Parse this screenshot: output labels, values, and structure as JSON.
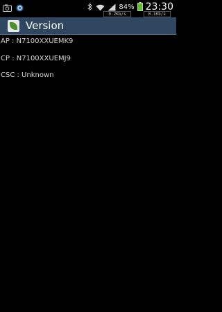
{
  "status_bar": {
    "battery_percent": "84%",
    "time": "23:30",
    "download_speed": "0.2Kb/s",
    "upload_speed": "0.1Kb/s",
    "icons": [
      "gallery-icon",
      "sync-icon",
      "bluetooth-icon",
      "wifi-icon",
      "signal-icon",
      "battery-icon"
    ]
  },
  "action_bar": {
    "title": "Version",
    "icon": "app-icon"
  },
  "version_info": [
    {
      "text": "AP : N7100XXUEMK9"
    },
    {
      "text": "CP : N7100XXUEMJ9"
    },
    {
      "text": "CSC : Unknown"
    }
  ]
}
